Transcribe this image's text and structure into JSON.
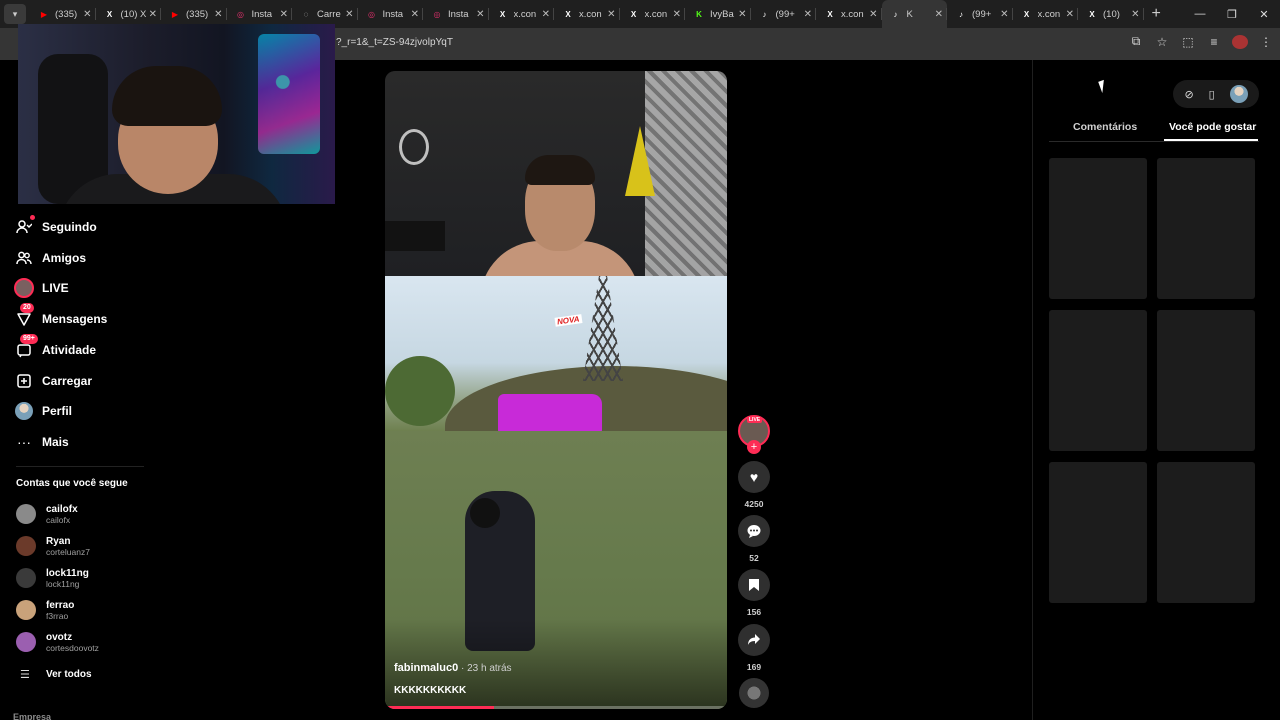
{
  "browser": {
    "tabs": [
      {
        "title": "(335)",
        "icon": "youtube-icon",
        "color": "#ff0000",
        "active": false
      },
      {
        "title": "(10) X",
        "icon": "x-icon",
        "color": "#ffffff",
        "active": false
      },
      {
        "title": "(335)",
        "icon": "youtube-icon",
        "color": "#ff0000",
        "active": false
      },
      {
        "title": "Insta",
        "icon": "instagram-icon",
        "color": "#e1306c",
        "active": false
      },
      {
        "title": "Carre",
        "icon": "loading-icon",
        "color": "#cccccc",
        "active": false
      },
      {
        "title": "Insta",
        "icon": "instagram-icon",
        "color": "#e1306c",
        "active": false
      },
      {
        "title": "Insta",
        "icon": "instagram-icon",
        "color": "#e1306c",
        "active": false
      },
      {
        "title": "x.con",
        "icon": "x-icon",
        "color": "#ffffff",
        "active": false
      },
      {
        "title": "x.con",
        "icon": "x-icon",
        "color": "#ffffff",
        "active": false
      },
      {
        "title": "x.con",
        "icon": "x-icon",
        "color": "#ffffff",
        "active": false
      },
      {
        "title": "IvyBa",
        "icon": "kick-icon",
        "color": "#53fc18",
        "active": false
      },
      {
        "title": "(99+",
        "icon": "tiktok-icon",
        "color": "#ffffff",
        "active": false
      },
      {
        "title": "x.con",
        "icon": "x-icon",
        "color": "#ffffff",
        "active": false
      },
      {
        "title": "K",
        "icon": "tiktok-icon",
        "color": "#ffffff",
        "active": true
      },
      {
        "title": "(99+",
        "icon": "tiktok-icon",
        "color": "#ffffff",
        "active": false
      },
      {
        "title": "x.con",
        "icon": "x-icon",
        "color": "#ffffff",
        "active": false
      },
      {
        "title": "(10)",
        "icon": "x-icon",
        "color": "#ffffff",
        "active": false
      }
    ],
    "url": "?_r=1&_t=ZS-94zjvolpYqT",
    "accent": "#fe2c55"
  },
  "sidebar": {
    "nav": [
      {
        "label": "Seguindo",
        "icon": "following-icon"
      },
      {
        "label": "Amigos",
        "icon": "friends-icon"
      },
      {
        "label": "LIVE",
        "icon": "live-icon"
      },
      {
        "label": "Mensagens",
        "icon": "messages-icon",
        "badge": "20"
      },
      {
        "label": "Atividade",
        "icon": "activity-icon",
        "badge": "99+"
      },
      {
        "label": "Carregar",
        "icon": "upload-icon"
      },
      {
        "label": "Perfil",
        "icon": "profile-icon"
      },
      {
        "label": "Mais",
        "icon": "more-icon"
      }
    ],
    "following_title": "Contas que você segue",
    "accounts": [
      {
        "name": "cailofx",
        "username": "cailofx",
        "color": "#8a8a8a"
      },
      {
        "name": "Ryan",
        "username": "corteluanz7",
        "color": "#6b3a2a"
      },
      {
        "name": "lock11ng",
        "username": "lock11ng",
        "color": "#3a3a3a"
      },
      {
        "name": "ferrao",
        "username": "f3rrao",
        "color": "#c9a27a"
      },
      {
        "name": "ovotz",
        "username": "cortesdoovotz",
        "color": "#9b5fb0"
      }
    ],
    "see_all": "Ver todos",
    "footer": "Empresa"
  },
  "video": {
    "author": "fabinmaluc0",
    "time": " · 23 h atrás",
    "caption": "KKKKKKKKKK",
    "overlay_text": "NOVA",
    "progress": 0.32
  },
  "actions": {
    "live_tag": "LIVE",
    "follow": "+",
    "likes": "4250",
    "comments": "52",
    "saves": "156",
    "shares": "169"
  },
  "right_panel": {
    "tabs": [
      "Comentários",
      "Você pode gostar"
    ],
    "active_tab": "Você pode gostar",
    "thumbnail_count": 6
  }
}
